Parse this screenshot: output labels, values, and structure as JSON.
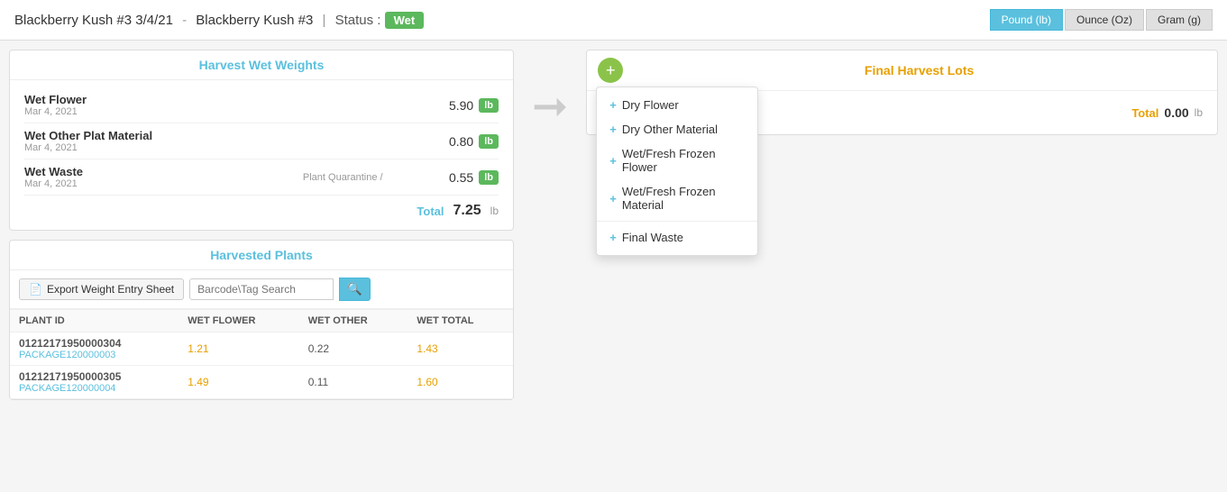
{
  "header": {
    "title": "Blackberry Kush #3 3/4/21",
    "separator": "-",
    "name": "Blackberry Kush #3",
    "status_label": "Status :",
    "status_value": "Wet",
    "units": [
      {
        "label": "Pound (lb)",
        "active": true
      },
      {
        "label": "Ounce (Oz)",
        "active": false
      },
      {
        "label": "Gram (g)",
        "active": false
      }
    ]
  },
  "harvest_wet_weights": {
    "title": "Harvest Wet Weights",
    "rows": [
      {
        "name": "Wet Flower",
        "date": "Mar 4, 2021",
        "quarantine": "",
        "value": "5.90",
        "unit": "lb"
      },
      {
        "name": "Wet Other Plat Material",
        "date": "Mar 4, 2021",
        "quarantine": "",
        "value": "0.80",
        "unit": "lb"
      },
      {
        "name": "Wet Waste",
        "date": "Mar 4, 2021",
        "quarantine": "Plant Quarantine /",
        "value": "0.55",
        "unit": "lb"
      }
    ],
    "total_label": "Total",
    "total_value": "7.25",
    "total_unit": "lb"
  },
  "arrow": "➔",
  "final_harvest_lots": {
    "title": "Final Harvest Lots",
    "add_button_label": "+",
    "dropdown_items": [
      {
        "label": "Dry Flower",
        "divider": false
      },
      {
        "label": "Dry Other Material",
        "divider": false
      },
      {
        "label": "Wet/Fresh Frozen Flower",
        "divider": false
      },
      {
        "label": "Wet/Fresh Frozen Material",
        "divider": false
      },
      {
        "label": "Final Waste",
        "divider": true
      }
    ],
    "total_label": "Total",
    "total_value": "0.00",
    "total_unit": "lb"
  },
  "harvested_plants": {
    "title": "Harvested Plants",
    "export_button": "Export Weight Entry Sheet",
    "search_placeholder": "Barcode\\Tag Search",
    "columns": [
      "Plant ID",
      "Wet Flower",
      "Wet Other",
      "Wet Total"
    ],
    "rows": [
      {
        "plant_id": "01212171950000304",
        "package_id": "PACKAGE120000003",
        "wet_flower": "1.21",
        "wet_other": "0.22",
        "wet_total": "1.43"
      },
      {
        "plant_id": "01212171950000305",
        "package_id": "PACKAGE120000004",
        "wet_flower": "1.49",
        "wet_other": "0.11",
        "wet_total": "1.60"
      }
    ]
  }
}
